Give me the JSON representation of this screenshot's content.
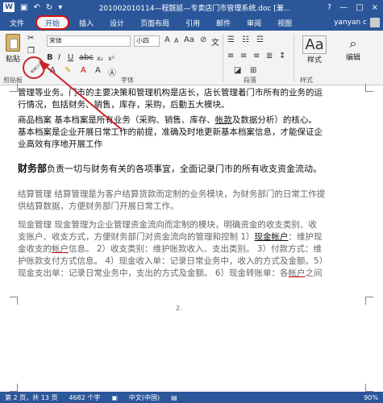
{
  "titlebar": {
    "title": "201002010114—程鼓延—专卖店门市管理系统.doc [兼...",
    "window_controls": [
      "?",
      "—",
      "□",
      "×"
    ]
  },
  "tabs": [
    "文件",
    "开始",
    "插入",
    "设计",
    "页面布局",
    "引用",
    "邮件",
    "审阅",
    "视图"
  ],
  "active_tab": "开始",
  "user": "yanyan c",
  "ribbon": {
    "paste_label": "粘贴",
    "font_name": "宋体",
    "font_size": "小四",
    "group_clipboard": "剪贴板",
    "group_font": "字体",
    "group_paragraph": "段落",
    "group_styles": "样式",
    "styles_label": "样式",
    "edit_label": "编辑"
  },
  "document": {
    "line1": "管理等业务。门市的主要决策和管理机构是店长，店长管理着门市所有的业务的运",
    "line2": "行情况，包括财务、销售，库存，采购，后勤五大模块。",
    "line3_a": "商品档案 基本档案是所有业务（采购、销售、库存、",
    "line3_b": "帐款",
    "line3_c": "及数据分析）的核心。",
    "line4": "基本档案是企业开展日常工作的前提，准确及时地更新基本档案信息，才能保证企",
    "line5": "业高效有序地开展工作",
    "finance_title": "财务部",
    "finance_text": "负责一切与财务有关的各项事宜，全面记录门市的所有收支资金流动。",
    "settle1": "结算管理 结算管理是为客户结算货款而定制的业务模块，为财务部门的日常工作提",
    "settle2": "供结算数据，方便财务部门开展日常工作。",
    "cash1": "现金管理 现金管理为企业管理资金流向而定制的模块，明确资金的收支类别、收",
    "cash2_a": "支账户、收支方式，方便财务部门对资金流向的管理和控制 1）",
    "cash2_b": "现金帐户",
    "cash2_c": "：维护现",
    "cash3_a": "金收支的",
    "cash3_b": "帐户",
    "cash3_c": "信息。 2）收支类别：维护账款收入、支出类别。 3）付款方式：维",
    "cash4": "护账款支付方式信息。 4）现金收入单：记录日常业务中，收入的方式及金额。5）",
    "cash5_a": "现金支出单：记录日常业务中，支出的方式及金额。 6）现金转账单：各",
    "cash5_b": "帐户",
    "cash5_c": "之间",
    "page_number": "2."
  },
  "status": {
    "page": "第 2 页，共 13 页",
    "words": "4682 个字",
    "language": "中文(中国)",
    "zoom": "90%"
  },
  "colors": {
    "brand": "#2b579a",
    "highlight_red": "#c9222b"
  }
}
